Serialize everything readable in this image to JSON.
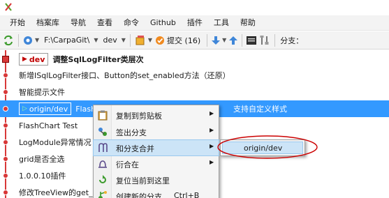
{
  "menubar": {
    "items": [
      "开始",
      "档案库",
      "导航",
      "查看",
      "命令",
      "Github",
      "插件",
      "工具",
      "帮助"
    ]
  },
  "toolbar": {
    "path": "F:\\CarpaGit\\",
    "branch": "dev",
    "commit_label": "提交 (16)",
    "branch_label": "分支："
  },
  "commits": [
    {
      "ref": "dev",
      "message": "调整SqlLogFilter类层次",
      "head": true
    },
    {
      "message": "新增ISqlLogFilter接口、Button的set_enabled方法（还原）"
    },
    {
      "message": "智能提示文件"
    },
    {
      "ref": "origin/dev",
      "message": "FlashC",
      "message_tail": "支持自定义样式",
      "selected": true
    },
    {
      "message": "FlashChart  Test"
    },
    {
      "message": "LogModule异常情况"
    },
    {
      "message": "grid是否全选"
    },
    {
      "message": "1.0.0.10插件"
    },
    {
      "message": "修改TreeView的get_"
    }
  ],
  "context_menu": {
    "items": [
      {
        "label": "复制到剪贴板",
        "submenu": true,
        "icon": "clipboard-icon"
      },
      {
        "label": "签出分支",
        "submenu": true,
        "icon": "checkout-branch-icon"
      },
      {
        "label": "和分支合并",
        "submenu": true,
        "icon": "merge-icon",
        "highlighted": true
      },
      {
        "label": "衍合在",
        "submenu": true,
        "icon": "rebase-icon"
      },
      {
        "label": "复位当前到这里",
        "submenu": false,
        "icon": "reset-icon"
      },
      {
        "label": "创建新的分支",
        "shortcut": "Ctrl+B",
        "icon": "new-branch-icon"
      }
    ]
  },
  "submenu": {
    "items": [
      {
        "label": "origin/dev"
      }
    ]
  },
  "colors": {
    "selection": "#3399ff",
    "graph": "#d83838",
    "menu_highlight": "#cce4f7",
    "annotation": "#cc0000"
  }
}
